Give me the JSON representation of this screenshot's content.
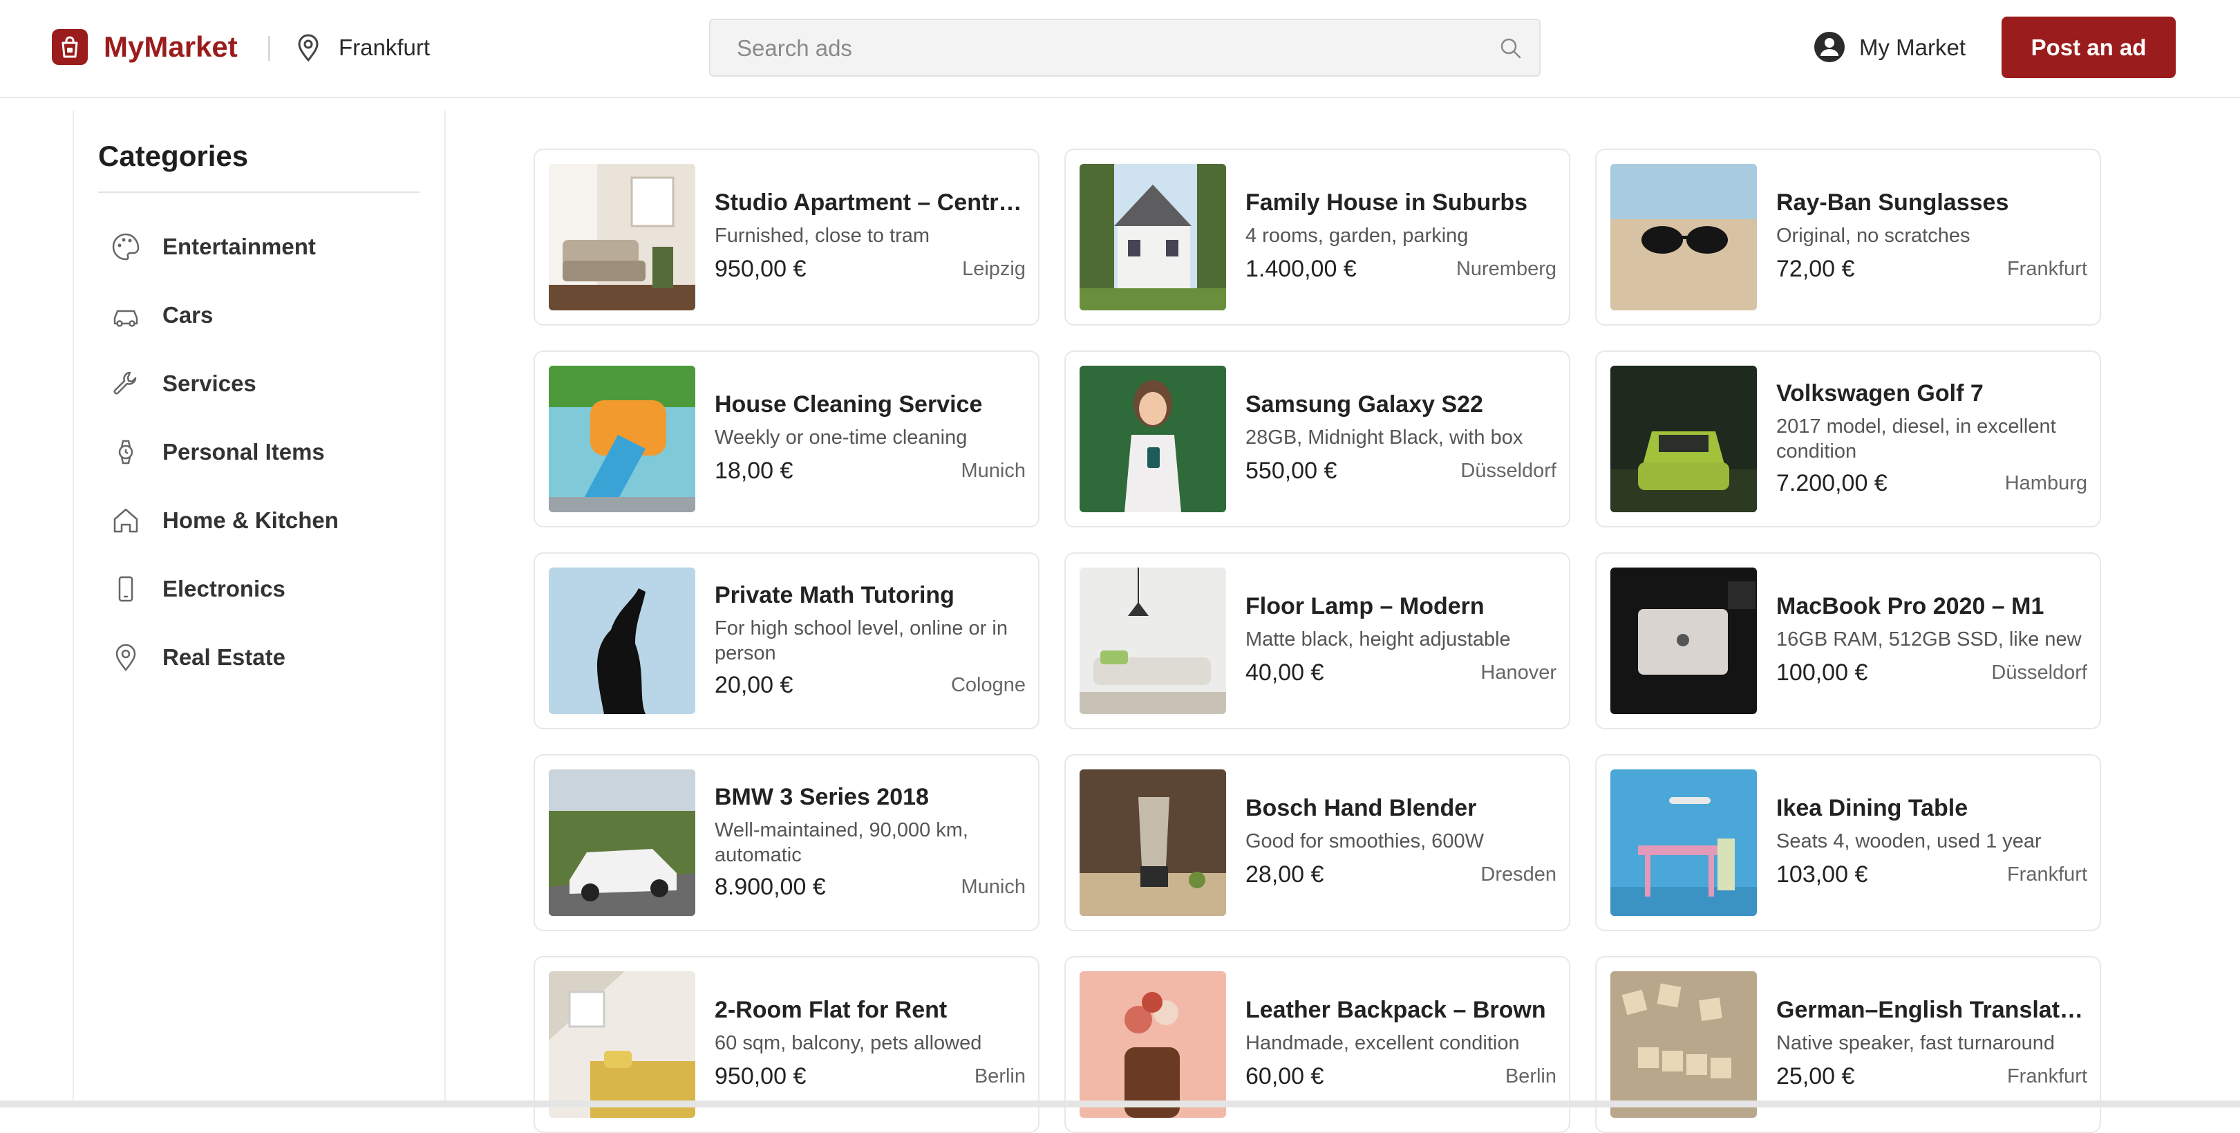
{
  "header": {
    "brand": "MyMarket",
    "location": "Frankfurt",
    "search_placeholder": "Search ads",
    "account_label": "My Market",
    "post_button": "Post an ad",
    "brand_color": "#9b1c1c"
  },
  "sidebar": {
    "title": "Categories",
    "items": [
      {
        "label": "Entertainment",
        "icon": "palette-icon"
      },
      {
        "label": "Cars",
        "icon": "car-icon"
      },
      {
        "label": "Services",
        "icon": "wrench-icon"
      },
      {
        "label": "Personal Items",
        "icon": "watch-icon"
      },
      {
        "label": "Home & Kitchen",
        "icon": "home-icon"
      },
      {
        "label": "Electronics",
        "icon": "phone-icon"
      },
      {
        "label": "Real Estate",
        "icon": "map-pin-icon"
      }
    ]
  },
  "listings": [
    {
      "title": "Studio Apartment – Central Location",
      "desc": "Furnished, close to tram",
      "price": "950,00 €",
      "city": "Leipzig"
    },
    {
      "title": "Family House in Suburbs",
      "desc": "4 rooms, garden, parking",
      "price": "1.400,00 €",
      "city": "Nuremberg"
    },
    {
      "title": "Ray-Ban Sunglasses",
      "desc": "Original, no scratches",
      "price": "72,00 €",
      "city": "Frankfurt"
    },
    {
      "title": "House Cleaning Service",
      "desc": "Weekly or one-time cleaning",
      "price": "18,00 €",
      "city": "Munich"
    },
    {
      "title": "Samsung Galaxy S22",
      "desc": "28GB, Midnight Black, with box",
      "price": "550,00 €",
      "city": "Düsseldorf"
    },
    {
      "title": "Volkswagen Golf 7",
      "desc": "2017 model, diesel, in excellent condition",
      "price": "7.200,00 €",
      "city": "Hamburg"
    },
    {
      "title": "Private Math Tutoring",
      "desc": "For high school level, online or in person",
      "price": "20,00 €",
      "city": "Cologne"
    },
    {
      "title": "Floor Lamp – Modern",
      "desc": "Matte black, height adjustable",
      "price": "40,00 €",
      "city": "Hanover"
    },
    {
      "title": "MacBook Pro 2020 – M1",
      "desc": "16GB RAM, 512GB SSD, like new",
      "price": "100,00 €",
      "city": "Düsseldorf"
    },
    {
      "title": "BMW 3 Series 2018",
      "desc": "Well-maintained, 90,000 km, automatic",
      "price": "8.900,00 €",
      "city": "Munich"
    },
    {
      "title": "Bosch Hand Blender",
      "desc": "Good for smoothies, 600W",
      "price": "28,00 €",
      "city": "Dresden"
    },
    {
      "title": "Ikea Dining Table",
      "desc": "Seats 4, wooden, used 1 year",
      "price": "103,00 €",
      "city": "Frankfurt"
    },
    {
      "title": "2-Room Flat for Rent",
      "desc": "60 sqm, balcony, pets allowed",
      "price": "950,00 €",
      "city": "Berlin"
    },
    {
      "title": "Leather Backpack – Brown",
      "desc": "Handmade, excellent condition",
      "price": "60,00 €",
      "city": "Berlin"
    },
    {
      "title": "German–English Translation",
      "desc": "Native speaker, fast turnaround",
      "price": "25,00 €",
      "city": "Frankfurt"
    }
  ]
}
